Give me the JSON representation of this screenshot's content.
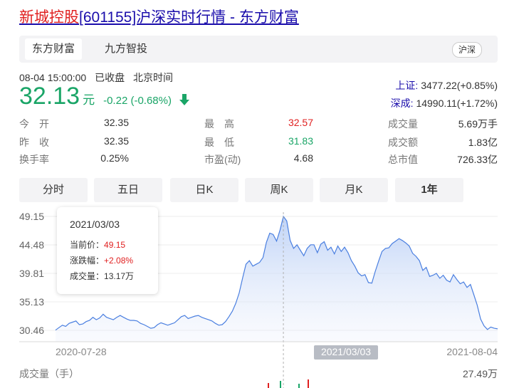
{
  "page": {
    "title_link_name": "新城控股",
    "title_rest": "[601155]沪深实时行情 - 东方财富"
  },
  "tabs": [
    "东方财富",
    "九方智投"
  ],
  "market_button": "沪深",
  "quote": {
    "timestamp": "08-04 15:00:00",
    "status": "已收盘",
    "timezone": "北京时间",
    "price": "32.13",
    "unit": "元",
    "change": "-0.22 (-0.68%)"
  },
  "indices": [
    {
      "name": "上证:",
      "value": "3477.22(+0.85%)"
    },
    {
      "name": "深成:",
      "value": "14990.11(+1.72%)"
    }
  ],
  "stats": {
    "col1": [
      {
        "label": "今　开",
        "value": "32.35"
      },
      {
        "label": "昨　收",
        "value": "32.35"
      },
      {
        "label": "换手率",
        "value": "0.25%"
      }
    ],
    "col2": [
      {
        "label": "最　高",
        "value": "32.57"
      },
      {
        "label": "最　低",
        "value": "31.83"
      },
      {
        "label": "市盈(动)",
        "value": "4.68"
      }
    ],
    "col3": [
      {
        "label": "成交量",
        "value": "5.69万手"
      },
      {
        "label": "成交额",
        "value": "1.83亿"
      },
      {
        "label": "总市值",
        "value": "726.33亿"
      }
    ]
  },
  "period_tabs": [
    "分时",
    "五日",
    "日K",
    "周K",
    "月K",
    "1年"
  ],
  "tooltip": {
    "date": "2021/03/03",
    "price_label": "当前价：",
    "price": "49.15",
    "pct_label": "涨跌幅：",
    "pct": "+2.08%",
    "vol_label": "成交量：",
    "vol": "13.17万"
  },
  "volume": {
    "label": "成交量（手）",
    "max": "27.49万"
  },
  "colors": {
    "up": "#e02020",
    "down": "#1aa567",
    "line": "#4a7fe0",
    "link": "#1a0dab"
  },
  "chart_data": {
    "type": "area",
    "x_start": "2020-07-28",
    "x_end": "2021-08-04",
    "x_tick_labels": [
      "2020-07-28",
      "2021/03/03",
      "2021-08-04"
    ],
    "y_tick_labels": [
      "49.15",
      "44.48",
      "39.81",
      "35.13",
      "30.46"
    ],
    "ylim": [
      30.46,
      49.15
    ],
    "crosshair_index": 67,
    "values": [
      30.5,
      30.9,
      31.3,
      31.1,
      31.6,
      31.8,
      32.0,
      31.4,
      31.5,
      31.9,
      32.1,
      32.6,
      32.2,
      32.5,
      33.1,
      32.6,
      32.4,
      32.2,
      32.6,
      32.9,
      32.6,
      32.3,
      32.1,
      32.1,
      32.0,
      31.6,
      31.4,
      31.1,
      30.8,
      30.9,
      31.4,
      31.7,
      31.5,
      31.3,
      31.5,
      31.7,
      32.2,
      32.7,
      32.9,
      32.4,
      32.6,
      32.8,
      32.9,
      32.6,
      32.4,
      32.2,
      32.0,
      31.6,
      31.3,
      31.4,
      31.9,
      32.7,
      33.6,
      34.9,
      36.6,
      39.0,
      41.3,
      41.9,
      41.0,
      41.3,
      41.6,
      42.4,
      44.9,
      46.4,
      46.2,
      45.1,
      46.9,
      49.15,
      48.4,
      45.2,
      43.9,
      44.5,
      43.6,
      42.7,
      43.9,
      44.5,
      44.5,
      43.2,
      44.6,
      45.0,
      43.6,
      44.1,
      43.0,
      44.3,
      43.4,
      44.1,
      43.2,
      41.9,
      41.0,
      39.9,
      39.4,
      39.6,
      38.3,
      38.2,
      40.1,
      41.8,
      43.4,
      43.9,
      44.0,
      44.7,
      45.1,
      45.5,
      45.2,
      44.8,
      44.3,
      43.1,
      42.6,
      41.9,
      40.3,
      40.8,
      39.3,
      39.5,
      39.8,
      39.0,
      39.5,
      38.7,
      38.4,
      39.6,
      38.8,
      38.1,
      38.4,
      37.5,
      38.0,
      36.3,
      34.6,
      32.3,
      31.2,
      30.6,
      31.0,
      30.8,
      30.7
    ]
  }
}
